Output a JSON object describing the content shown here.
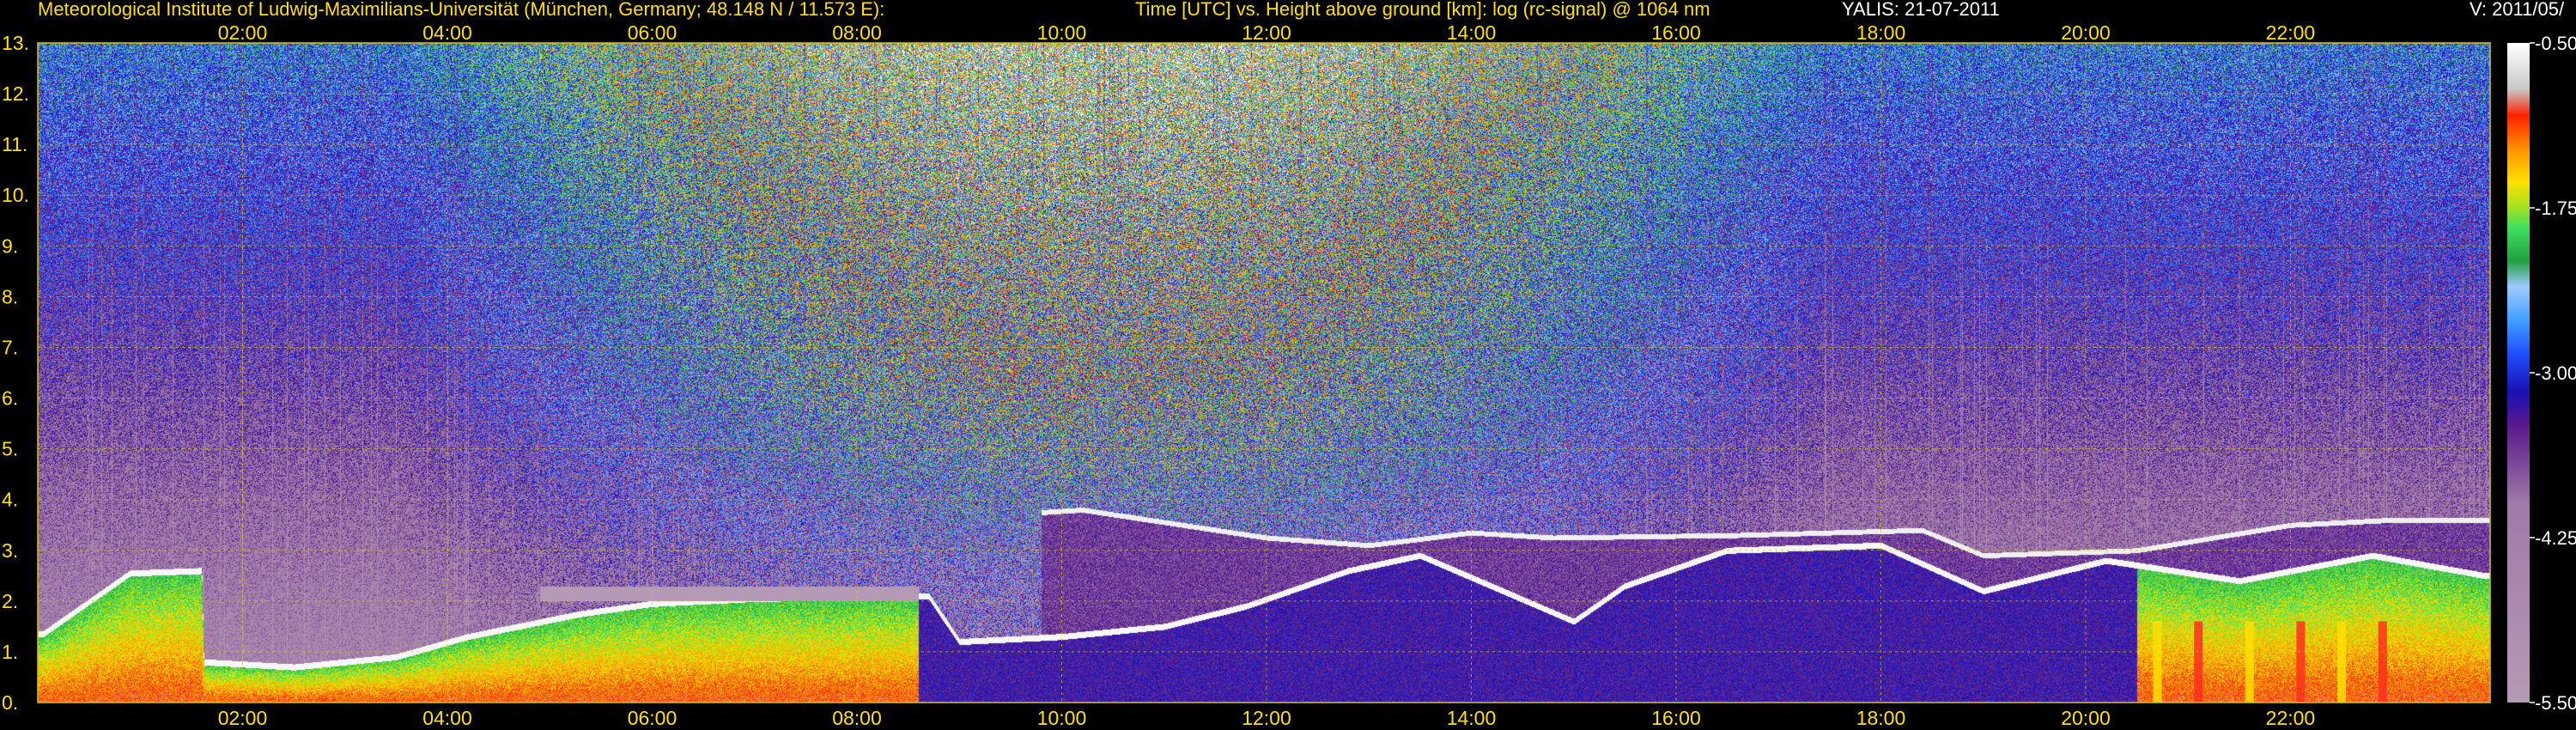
{
  "header": {
    "institute": "Meteorological Institute of Ludwig-Maximilians-Universität (München, Germany; 48.148 N / 11.573 E):",
    "axes_description": "Time [UTC] vs. Height above ground [km]: log (rc-signal) @ 1064 nm",
    "instrument_date": "YALIS: 21-07-2011",
    "version": "V: 2011/05/"
  },
  "colors": {
    "text": "#ffe000",
    "grid": "#d8c800",
    "background": "#000000"
  },
  "chart_data": {
    "type": "heatmap",
    "title": "Time [UTC] vs. Height above ground [km]: log (rc-signal) @ 1064 nm",
    "x_unit": "hours UTC",
    "xlim": [
      0.0,
      23.95
    ],
    "ylim": [
      0,
      13
    ],
    "x_ticks": [
      {
        "value": 2,
        "label": "02:00"
      },
      {
        "value": 4,
        "label": "04:00"
      },
      {
        "value": 6,
        "label": "06:00"
      },
      {
        "value": 8,
        "label": "08:00"
      },
      {
        "value": 10,
        "label": "10:00"
      },
      {
        "value": 12,
        "label": "12:00"
      },
      {
        "value": 14,
        "label": "14:00"
      },
      {
        "value": 16,
        "label": "16:00"
      },
      {
        "value": 18,
        "label": "18:00"
      },
      {
        "value": 20,
        "label": "20:00"
      },
      {
        "value": 22,
        "label": "22:00"
      }
    ],
    "y_ticks": [
      {
        "value": 0,
        "label": "0."
      },
      {
        "value": 1,
        "label": "1."
      },
      {
        "value": 2,
        "label": "2."
      },
      {
        "value": 3,
        "label": "3."
      },
      {
        "value": 4,
        "label": "4."
      },
      {
        "value": 5,
        "label": "5."
      },
      {
        "value": 6,
        "label": "6."
      },
      {
        "value": 7,
        "label": "7."
      },
      {
        "value": 8,
        "label": "8."
      },
      {
        "value": 9,
        "label": "9."
      },
      {
        "value": 10,
        "label": "10."
      },
      {
        "value": 11,
        "label": "11."
      },
      {
        "value": 12,
        "label": "12."
      },
      {
        "value": 13,
        "label": "13."
      }
    ],
    "grid": true,
    "colorbar": {
      "range": [
        -5.5,
        -0.5
      ],
      "ticks": [
        {
          "value": -0.5,
          "label": "-0.50"
        },
        {
          "value": -1.75,
          "label": "-1.75"
        },
        {
          "value": -3.0,
          "label": "-3.00"
        },
        {
          "value": -4.25,
          "label": "-4.25"
        },
        {
          "value": -5.5,
          "label": "-5.50"
        }
      ],
      "stops": [
        {
          "value": -5.5,
          "color": "#b49ab4"
        },
        {
          "value": -4.0,
          "color": "#a07aa8"
        },
        {
          "value": -3.4,
          "color": "#5a1a8c"
        },
        {
          "value": -3.15,
          "color": "#1a10b4"
        },
        {
          "value": -2.85,
          "color": "#2050ff"
        },
        {
          "value": -2.6,
          "color": "#40a0ff"
        },
        {
          "value": -2.35,
          "color": "#a0c8ff"
        },
        {
          "value": -2.15,
          "color": "#20a040"
        },
        {
          "value": -1.9,
          "color": "#40e060"
        },
        {
          "value": -1.75,
          "color": "#a0e020"
        },
        {
          "value": -1.55,
          "color": "#ffe000"
        },
        {
          "value": -1.3,
          "color": "#ff9000"
        },
        {
          "value": -1.05,
          "color": "#ff2000"
        },
        {
          "value": -0.85,
          "color": "#c8c8c8"
        },
        {
          "value": -0.5,
          "color": "#ffffff"
        }
      ]
    },
    "features": {
      "boundary_layer_top_km": [
        {
          "time": 0.05,
          "height": 1.35
        },
        {
          "time": 0.9,
          "height": 2.55
        },
        {
          "time": 1.6,
          "height": 2.6
        },
        {
          "time": 1.62,
          "height": 0.8
        },
        {
          "time": 2.5,
          "height": 0.7
        },
        {
          "time": 3.5,
          "height": 0.9
        },
        {
          "time": 4.2,
          "height": 1.3
        },
        {
          "time": 5.3,
          "height": 1.75
        },
        {
          "time": 6.0,
          "height": 1.95
        },
        {
          "time": 7.0,
          "height": 2.05
        },
        {
          "time": 8.7,
          "height": 2.1
        },
        {
          "time": 9.0,
          "height": 1.2
        },
        {
          "time": 10.0,
          "height": 1.3
        },
        {
          "time": 11.0,
          "height": 1.5
        },
        {
          "time": 11.8,
          "height": 1.9
        },
        {
          "time": 12.8,
          "height": 2.6
        },
        {
          "time": 13.5,
          "height": 2.9
        },
        {
          "time": 15.0,
          "height": 1.6
        },
        {
          "time": 15.5,
          "height": 2.3
        },
        {
          "time": 16.5,
          "height": 3.0
        },
        {
          "time": 18.0,
          "height": 3.1
        },
        {
          "time": 19.0,
          "height": 2.2
        },
        {
          "time": 20.2,
          "height": 2.8
        },
        {
          "time": 21.5,
          "height": 2.4
        },
        {
          "time": 22.8,
          "height": 2.9
        },
        {
          "time": 23.9,
          "height": 2.5
        }
      ],
      "residual_layer_top_km": [
        {
          "time": 9.8,
          "height": 3.75
        },
        {
          "time": 10.2,
          "height": 3.8
        },
        {
          "time": 12.0,
          "height": 3.25
        },
        {
          "time": 13.0,
          "height": 3.1
        },
        {
          "time": 14.0,
          "height": 3.35
        },
        {
          "time": 14.8,
          "height": 3.25
        },
        {
          "time": 16.6,
          "height": 3.3
        },
        {
          "time": 18.4,
          "height": 3.4
        },
        {
          "time": 19.0,
          "height": 2.9
        },
        {
          "time": 20.5,
          "height": 3.0
        },
        {
          "time": 22.0,
          "height": 3.5
        },
        {
          "time": 23.0,
          "height": 3.6
        }
      ],
      "dense_aerosol_layer": {
        "t_start": 4.9,
        "t_end": 8.6,
        "bottom_km": 2.0,
        "top_km": 2.3
      },
      "low_cloud_spikes_hours": [
        20.7,
        21.1,
        21.6,
        22.1,
        22.5,
        22.9
      ]
    }
  }
}
